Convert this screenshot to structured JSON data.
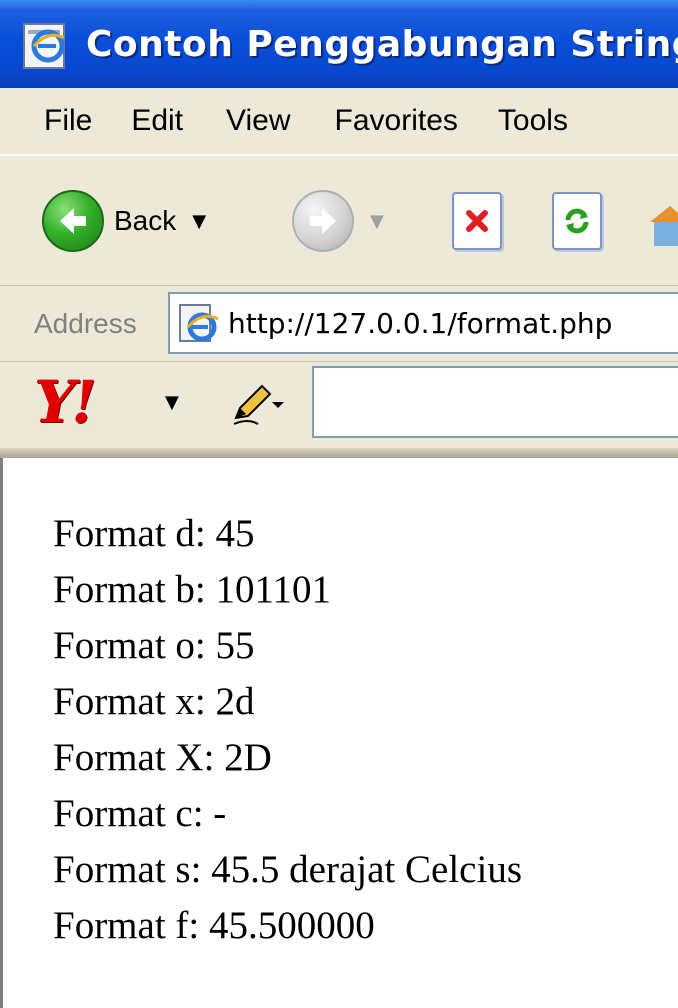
{
  "window": {
    "title": "Contoh Penggabungan String",
    "icon": "ie-page-icon"
  },
  "menu": {
    "items": [
      "File",
      "Edit",
      "View",
      "Favorites",
      "Tools"
    ]
  },
  "toolbar": {
    "back_label": "Back"
  },
  "address": {
    "label": "Address",
    "url": "http://127.0.0.1/format.php"
  },
  "yahoo": {
    "logo_text": "Y!",
    "search_placeholder": ""
  },
  "content": {
    "lines": [
      "Format d: 45",
      "Format b: 101101",
      "Format o: 55",
      "Format x: 2d",
      "Format X: 2D",
      "Format c: -",
      "Format s: 45.5 derajat Celcius",
      "Format f: 45.500000"
    ]
  },
  "colors": {
    "titlebar": "#0a4fd8",
    "chrome": "#ece9d8",
    "back_green": "#34b02a",
    "yahoo_red": "#e00000"
  }
}
